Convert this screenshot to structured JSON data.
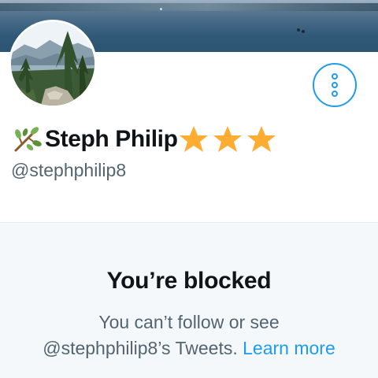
{
  "profile": {
    "display_name": "Steph Philip",
    "handle": "@stephphilip8",
    "name_prefix_icon": "herb-branch-icon",
    "name_suffix_icons": [
      "star-icon",
      "star-icon",
      "star-icon"
    ],
    "banner_image": "lake-shoreline",
    "avatar_image": "mountain-lake-forest",
    "more_button_icon": "more-options-icon"
  },
  "blocked": {
    "title": "You’re blocked",
    "line1": "You can’t follow or see",
    "line2_text": "@stephphilip8’s Tweets. ",
    "learn_more": "Learn more"
  },
  "colors": {
    "accent": "#1d9bf0",
    "text_primary": "#0f1419",
    "text_secondary": "#536471",
    "star": "#ffac33",
    "blocked_background": "#f5f8fa"
  }
}
